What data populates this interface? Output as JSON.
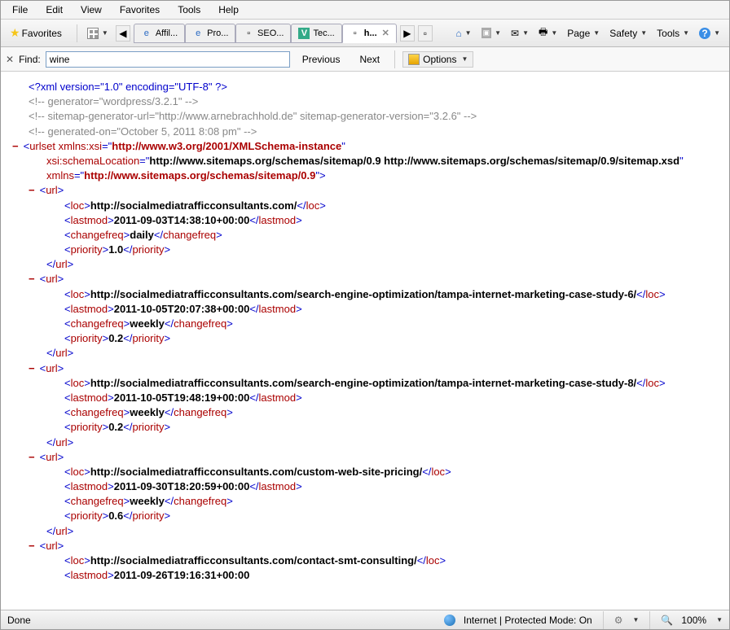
{
  "menu": [
    "File",
    "Edit",
    "View",
    "Favorites",
    "Tools",
    "Help"
  ],
  "toolbar": {
    "favorites_label": "Favorites",
    "tabs": [
      "Affil...",
      "Pro...",
      "SEO...",
      "Tec...",
      "h..."
    ],
    "right": [
      "Page",
      "Safety",
      "Tools"
    ]
  },
  "findbar": {
    "label": "Find:",
    "value": "wine",
    "prev": "Previous",
    "next": "Next",
    "options": "Options"
  },
  "xml": {
    "decl": "<?xml version=\"1.0\" encoding=\"UTF-8\" ?>",
    "c1": "<!--  generator=\"wordpress/3.2.1\"  -->",
    "c2": "<!--  sitemap-generator-url=\"http://www.arnebrachhold.de\" sitemap-generator-version=\"3.2.6\"   -->",
    "c3": "<!--  generated-on=\"October 5, 2011 8:08 pm\"  -->",
    "urlset": {
      "l1a": "urlset",
      "l1b": "xmlns:xsi",
      "l1c": "http://www.w3.org/2001/XMLSchema-instance",
      "l2a": "xsi:schemaLocation",
      "l2b": "http://www.sitemaps.org/schemas/sitemap/0.9 http://www.sitemaps.org/schemas/sitemap/0.9/sitemap.xsd",
      "l3a": "xmlns",
      "l3b": "http://www.sitemaps.org/schemas/sitemap/0.9"
    },
    "urls": [
      {
        "loc": "http://socialmediatrafficconsultants.com/",
        "lastmod": "2011-09-03T14:38:10+00:00",
        "changefreq": "daily",
        "priority": "1.0"
      },
      {
        "loc": "http://socialmediatrafficconsultants.com/search-engine-optimization/tampa-internet-marketing-case-study-6/",
        "lastmod": "2011-10-05T20:07:38+00:00",
        "changefreq": "weekly",
        "priority": "0.2"
      },
      {
        "loc": "http://socialmediatrafficconsultants.com/search-engine-optimization/tampa-internet-marketing-case-study-8/",
        "lastmod": "2011-10-05T19:48:19+00:00",
        "changefreq": "weekly",
        "priority": "0.2"
      },
      {
        "loc": "http://socialmediatrafficconsultants.com/custom-web-site-pricing/",
        "lastmod": "2011-09-30T18:20:59+00:00",
        "changefreq": "weekly",
        "priority": "0.6"
      },
      {
        "loc": "http://socialmediatrafficconsultants.com/contact-smt-consulting/",
        "lastmod": "2011-09-26T19:16:31+00:00"
      }
    ]
  },
  "status": {
    "done": "Done",
    "zone": "Internet | Protected Mode: On",
    "zoom": "100%"
  }
}
